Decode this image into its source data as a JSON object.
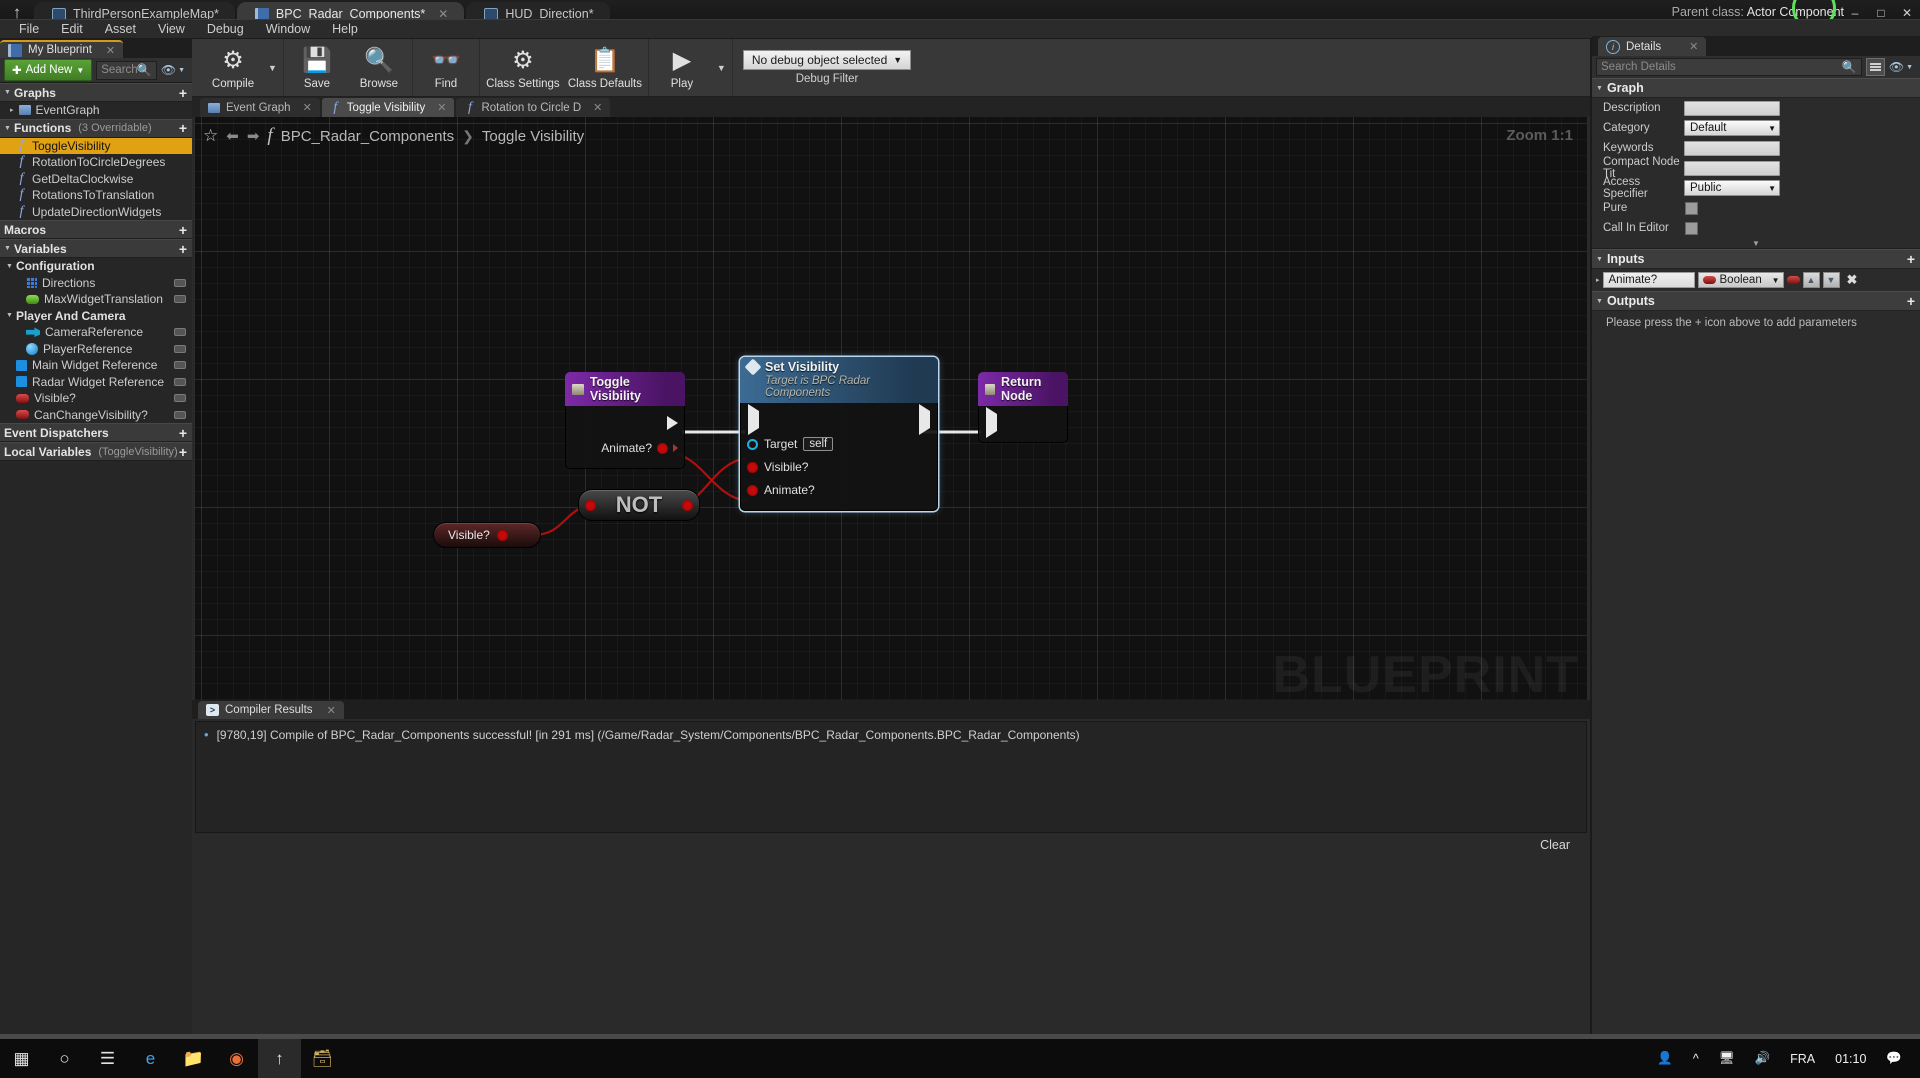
{
  "titlebar": {
    "tabs": [
      {
        "label": "ThirdPersonExampleMap*",
        "icon": "map-icon",
        "active": false
      },
      {
        "label": "BPC_Radar_Components*",
        "icon": "blueprint-icon",
        "active": true
      },
      {
        "label": "HUD_Direction*",
        "icon": "hud-icon",
        "active": false
      }
    ],
    "parent_class_label": "Parent class:",
    "parent_class_value": "Actor Component",
    "window_minimize": "–",
    "window_maximize": "□",
    "window_close": "✕"
  },
  "menubar": {
    "items": [
      "File",
      "Edit",
      "Asset",
      "View",
      "Debug",
      "Window",
      "Help"
    ]
  },
  "myblueprint": {
    "tab_label": "My Blueprint",
    "add_new_label": "Add New",
    "search_placeholder": "Search",
    "sections": {
      "graphs": {
        "title": "Graphs",
        "items": [
          {
            "label": "EventGraph",
            "icon": "event-graph-icon"
          }
        ]
      },
      "functions": {
        "title": "Functions",
        "subtitle": "(3 Overridable)",
        "items": [
          {
            "label": "ToggleVisibility",
            "icon": "function-icon",
            "selected": true
          },
          {
            "label": "RotationToCircleDegrees",
            "icon": "function-icon",
            "selected": false
          },
          {
            "label": "GetDeltaClockwise",
            "icon": "function-icon",
            "selected": false
          },
          {
            "label": "RotationsToTranslation",
            "icon": "function-icon",
            "selected": false
          },
          {
            "label": "UpdateDirectionWidgets",
            "icon": "function-icon",
            "selected": false
          }
        ]
      },
      "macros": {
        "title": "Macros"
      },
      "variables": {
        "title": "Variables"
      },
      "configuration": {
        "title": "Configuration",
        "items": [
          {
            "label": "Directions",
            "icon": "array-grid-icon"
          },
          {
            "label": "MaxWidgetTranslation",
            "icon": "float-pill-icon"
          }
        ]
      },
      "player_and_camera": {
        "title": "Player And Camera",
        "items": [
          {
            "label": "CameraReference",
            "icon": "camera-icon"
          },
          {
            "label": "PlayerReference",
            "icon": "sphere-icon"
          }
        ]
      },
      "ungrouped": [
        {
          "label": "Main Widget Reference",
          "icon": "object-square-icon"
        },
        {
          "label": "Radar Widget Reference",
          "icon": "object-square-icon"
        },
        {
          "label": "Visible?",
          "icon": "boolean-pill-icon"
        },
        {
          "label": "CanChangeVisibility?",
          "icon": "boolean-pill-icon"
        }
      ],
      "event_dispatchers": {
        "title": "Event Dispatchers"
      },
      "local_variables": {
        "title": "Local Variables",
        "subtitle": "(ToggleVisibility)"
      }
    }
  },
  "toolbar": {
    "buttons": [
      {
        "label": "Compile",
        "icon": "compile-gear-check-icon"
      },
      {
        "label": "Save",
        "icon": "save-floppy-icon"
      },
      {
        "label": "Browse",
        "icon": "browse-magnifier-icon"
      },
      {
        "label": "Find",
        "icon": "find-binoculars-icon"
      },
      {
        "label": "Class Settings",
        "icon": "class-settings-icon"
      },
      {
        "label": "Class Defaults",
        "icon": "class-defaults-icon"
      },
      {
        "label": "Play",
        "icon": "play-triangle-icon"
      }
    ],
    "debug_filter_value": "No debug object selected",
    "debug_filter_label": "Debug Filter"
  },
  "graph_tabs": [
    {
      "label": "Event Graph",
      "icon": "event-graph-icon",
      "active": false
    },
    {
      "label": "Toggle Visibility",
      "icon": "function-icon",
      "active": true
    },
    {
      "label": "Rotation to Circle D",
      "icon": "function-icon",
      "active": false
    }
  ],
  "graph": {
    "breadcrumb_root": "BPC_Radar_Components",
    "breadcrumb_sep": "❯",
    "breadcrumb_leaf": "Toggle Visibility",
    "zoom_label": "Zoom 1:1",
    "watermark": "BLUEPRINT",
    "nodes": {
      "entry": {
        "title": "Toggle Visibility",
        "out_pins": [
          {
            "label": "Animate?",
            "type": "bool"
          }
        ]
      },
      "set_visibility": {
        "title": "Set Visibility",
        "subtitle": "Target is BPC Radar Components",
        "in_pins": [
          {
            "label": "Target",
            "type": "object",
            "value": "self"
          },
          {
            "label": "Visibile?",
            "type": "bool"
          },
          {
            "label": "Animate?",
            "type": "bool"
          }
        ]
      },
      "return": {
        "title": "Return Node"
      },
      "not": {
        "title": "NOT"
      },
      "visible_var": {
        "title": "Visible?"
      }
    }
  },
  "compiler": {
    "tab_label": "Compiler Results",
    "message": "[9780,19] Compile of BPC_Radar_Components successful! [in 291 ms] (/Game/Radar_System/Components/BPC_Radar_Components.BPC_Radar_Components)",
    "clear_label": "Clear"
  },
  "details": {
    "tab_label": "Details",
    "search_placeholder": "Search Details",
    "graph_section": "Graph",
    "rows": [
      {
        "label": "Description",
        "control": "text",
        "value": ""
      },
      {
        "label": "Category",
        "control": "select",
        "value": "Default"
      },
      {
        "label": "Keywords",
        "control": "text",
        "value": ""
      },
      {
        "label": "Compact Node Tit",
        "control": "text",
        "value": ""
      },
      {
        "label": "Access Specifier",
        "control": "select",
        "value": "Public"
      },
      {
        "label": "Pure",
        "control": "checkbox",
        "value": ""
      },
      {
        "label": "Call In Editor",
        "control": "checkbox",
        "value": ""
      }
    ],
    "inputs_section": "Inputs",
    "inputs": [
      {
        "name": "Animate?",
        "type": "Boolean"
      }
    ],
    "outputs_section": "Outputs",
    "outputs_empty": "Please press the + icon above to add parameters"
  },
  "taskbar": {
    "items": [
      {
        "icon": "windows-start-icon"
      },
      {
        "icon": "cortana-search-icon"
      },
      {
        "icon": "task-view-icon"
      },
      {
        "icon": "edge-browser-icon"
      },
      {
        "icon": "file-explorer-icon"
      },
      {
        "icon": "chrome-browser-icon"
      },
      {
        "icon": "unreal-engine-icon"
      },
      {
        "icon": "unreal-project-icon"
      }
    ],
    "tray": {
      "people_icon": "people-icon",
      "chevron_icon": "show-hidden-icons-icon",
      "network_icon": "network-icon",
      "volume_icon": "volume-icon",
      "language": "FRA",
      "clock": "01:10",
      "notification_icon": "action-center-icon"
    }
  },
  "colors": {
    "accent_orange": "#e0a112",
    "exec_white": "#e8e8e8",
    "bool_red": "#c40a0a",
    "object_blue": "#11b5e8",
    "node_purple": "#7d2aa8",
    "node_blue": "#3c6b93",
    "green_add": "#59a337"
  }
}
